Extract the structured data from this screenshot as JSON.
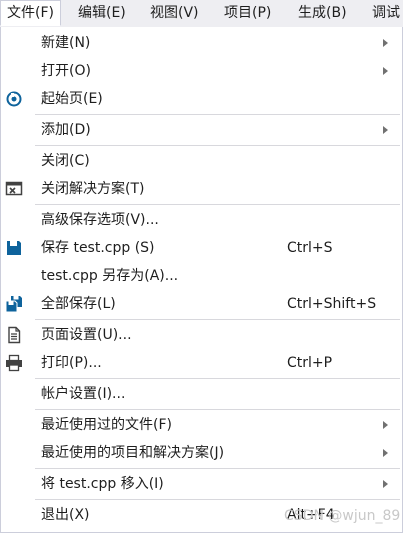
{
  "menubar": {
    "items": [
      {
        "label": "文件(F)"
      },
      {
        "label": "编辑(E)"
      },
      {
        "label": "视图(V)"
      },
      {
        "label": "项目(P)"
      },
      {
        "label": "生成(B)"
      },
      {
        "label": "调试"
      }
    ]
  },
  "file_menu": {
    "items": [
      {
        "label": "新建(N)",
        "submenu": true
      },
      {
        "label": "打开(O)",
        "submenu": true
      },
      {
        "label": "起始页(E)",
        "icon": "start-page-icon"
      },
      {
        "label": "添加(D)",
        "submenu": true
      },
      {
        "label": "关闭(C)"
      },
      {
        "label": "关闭解决方案(T)",
        "icon": "close-solution-icon"
      },
      {
        "label": "高级保存选项(V)..."
      },
      {
        "label": "保存 test.cpp (S)",
        "shortcut": "Ctrl+S",
        "icon": "save-icon"
      },
      {
        "label": "test.cpp 另存为(A)..."
      },
      {
        "label": "全部保存(L)",
        "shortcut": "Ctrl+Shift+S",
        "icon": "save-all-icon"
      },
      {
        "label": "页面设置(U)...",
        "icon": "page-setup-icon"
      },
      {
        "label": "打印(P)...",
        "shortcut": "Ctrl+P",
        "icon": "printer-icon"
      },
      {
        "label": "帐户设置(I)..."
      },
      {
        "label": "最近使用过的文件(F)",
        "submenu": true
      },
      {
        "label": "最近使用的项目和解决方案(J)",
        "submenu": true
      },
      {
        "label": "将 test.cpp 移入(I)",
        "submenu": true
      },
      {
        "label": "退出(X)",
        "shortcut": "Alt+F4"
      }
    ]
  },
  "watermark": {
    "text": "CSDN @wjun_89"
  },
  "colors": {
    "menubar_bg": "#eeeef2",
    "border": "#cccedb",
    "icon_blue": "#0e639c",
    "icon_dark": "#424242"
  }
}
